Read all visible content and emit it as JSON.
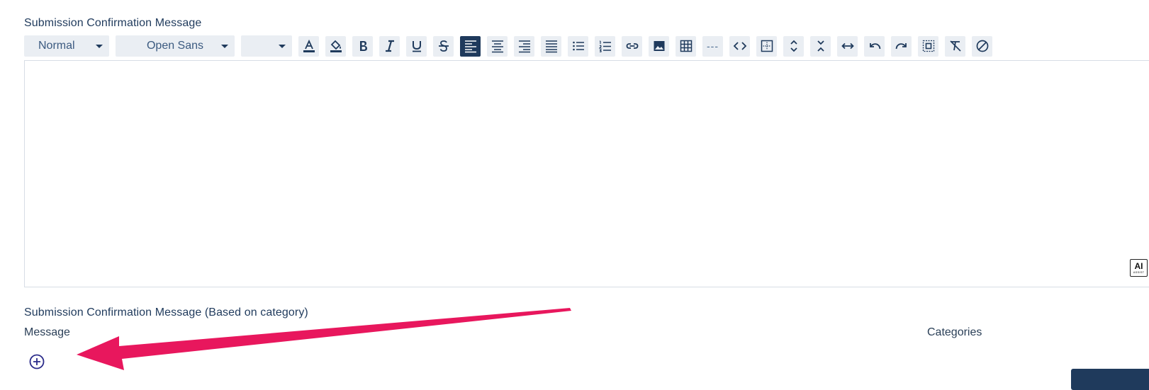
{
  "editor_section": {
    "title": "Submission Confirmation Message",
    "format_dropdown": "Normal",
    "font_dropdown": "Open Sans",
    "size_dropdown": "",
    "editor_content": "",
    "ai_badge": {
      "label": "AI",
      "sublabel": "ASSIST"
    }
  },
  "toolbar_icons": [
    "font-color-icon",
    "background-color-icon",
    "bold-icon",
    "italic-icon",
    "underline-icon",
    "strikethrough-icon",
    "align-left-icon",
    "align-center-icon",
    "align-right-icon",
    "align-justify-icon",
    "bullet-list-icon",
    "numbered-list-icon",
    "link-icon",
    "image-icon",
    "table-icon",
    "horizontal-rule-icon",
    "code-view-icon",
    "special-chars-icon",
    "expand-vertical-icon",
    "collapse-vertical-icon",
    "expand-horizontal-icon",
    "undo-icon",
    "redo-icon",
    "select-all-icon",
    "clear-formatting-icon",
    "remove-icon"
  ],
  "horizontal_rule_text": "---",
  "category_section": {
    "title": "Submission Confirmation Message (Based on category)",
    "columns": {
      "message": "Message",
      "categories": "Categories"
    }
  },
  "colors": {
    "primary": "#1f3a5c",
    "toolbar_bg": "#eaeef3",
    "annotation_arrow": "#e8175d",
    "add_icon": "#2a2a8a"
  }
}
